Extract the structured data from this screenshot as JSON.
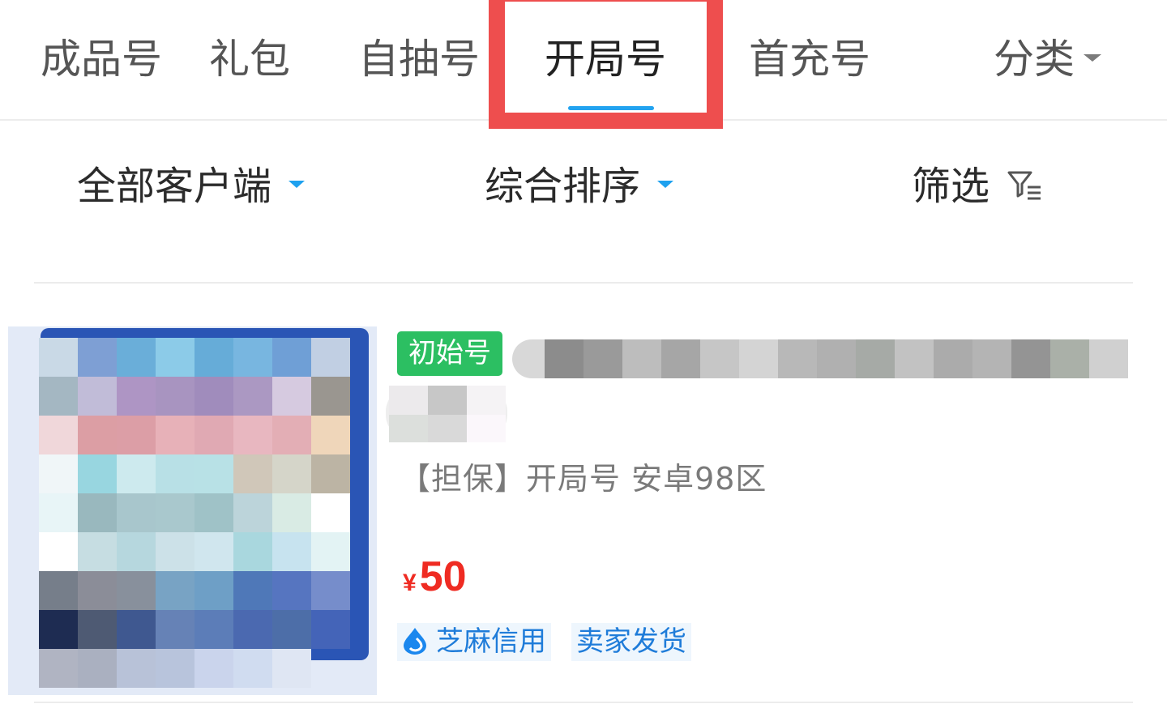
{
  "tabs": [
    {
      "label": "成品号"
    },
    {
      "label": "礼包"
    },
    {
      "label": "自抽号"
    },
    {
      "label": "开局号",
      "active": true
    },
    {
      "label": "首充号"
    },
    {
      "label": "分类"
    }
  ],
  "filters": {
    "client": "全部客户端",
    "sort": "综合排序",
    "filter": "筛选"
  },
  "product": {
    "badge": "初始号",
    "description": "【担保】开局号  安卓98区",
    "currency": "¥",
    "price": "50",
    "tags": [
      "芝麻信用",
      "卖家发货"
    ]
  },
  "colors": {
    "accent_blue": "#22a3f0",
    "highlight_red": "#ee4e4e",
    "badge_green": "#2cbf62",
    "price_red": "#ef2b22"
  },
  "icons": [
    "filter-funnel-icon",
    "sesame-credit-drop-icon",
    "caret-down-icon"
  ]
}
